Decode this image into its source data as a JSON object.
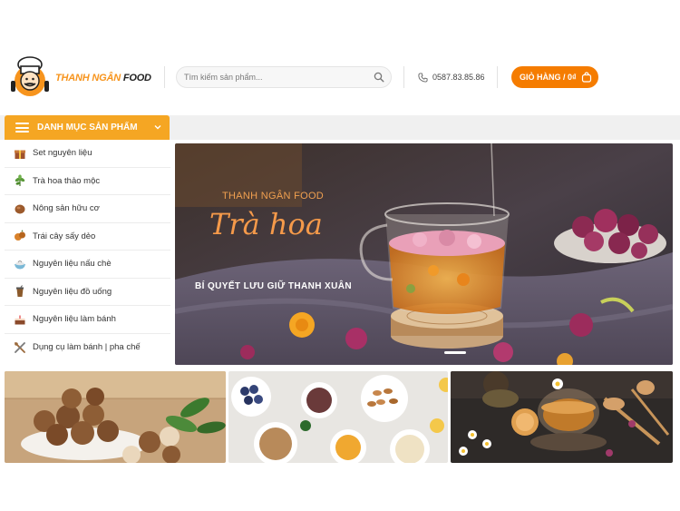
{
  "header": {
    "logo": {
      "brand_part1": "THANH NGÂN",
      "brand_part2": "FOOD"
    },
    "search": {
      "placeholder": "Tìm kiếm sản phẩm..."
    },
    "phone": "0587.83.85.86",
    "cart_label": "GIỎ HÀNG / 0₫"
  },
  "nav": {
    "category_toggle_label": "DANH MỤC SẢN PHẨM"
  },
  "sidebar": {
    "items": [
      {
        "label": "Set nguyên liệu",
        "icon": "gift-box-icon"
      },
      {
        "label": "Trà hoa thảo mộc",
        "icon": "herb-leaf-icon"
      },
      {
        "label": "Nông sản hữu cơ",
        "icon": "nut-icon"
      },
      {
        "label": "Trái cây sấy dẻo",
        "icon": "dried-fruit-icon"
      },
      {
        "label": "Nguyên liệu nấu chè",
        "icon": "dessert-bowl-icon"
      },
      {
        "label": "Nguyên liệu đồ uống",
        "icon": "drink-cup-icon"
      },
      {
        "label": "Nguyên liệu làm bánh",
        "icon": "cake-icon"
      },
      {
        "label": "Dụng cụ làm bánh | pha chế",
        "icon": "utensils-icon"
      }
    ]
  },
  "hero": {
    "brand": "THANH NGÂN FOOD",
    "title": "Trà hoa",
    "subtitle": "BÍ QUYẾT LƯU GIỮ THANH XUÂN"
  },
  "colors": {
    "accent": "#f57c00",
    "category_bar": "#f5a623",
    "brand_orange": "#f7941d"
  }
}
